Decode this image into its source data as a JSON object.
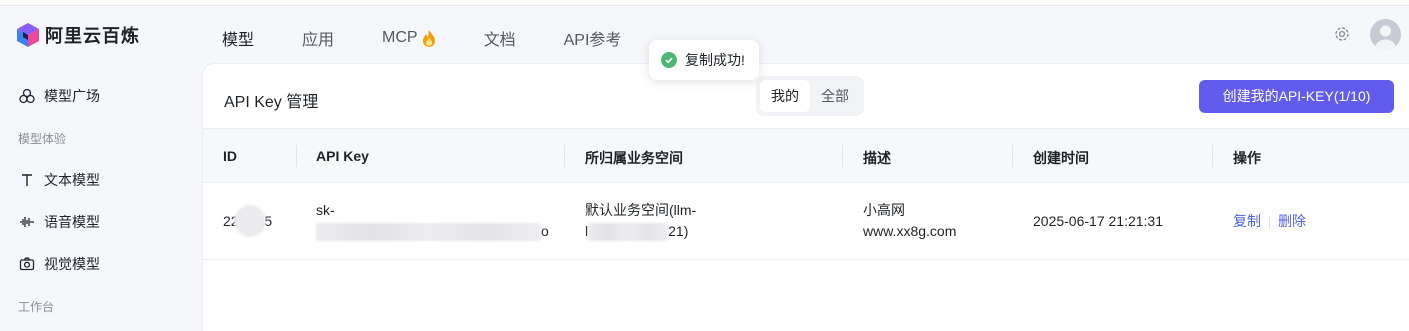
{
  "brand": {
    "name": "阿里云百炼"
  },
  "nav": {
    "items": [
      "模型",
      "应用",
      "MCP",
      "文档",
      "API参考"
    ],
    "active": "模型"
  },
  "toast": {
    "text": "复制成功!"
  },
  "sidebar": {
    "model_square": "模型广场",
    "group_experience": "模型体验",
    "text_model": "文本模型",
    "voice_model": "语音模型",
    "vision_model": "视觉模型",
    "group_workbench": "工作台"
  },
  "panel": {
    "title": "API Key 管理",
    "filter_mine": "我的",
    "filter_all": "全部",
    "create_button": "创建我的API-KEY(1/10)"
  },
  "table": {
    "columns": [
      "ID",
      "API Key",
      "所归属业务空间",
      "描述",
      "创建时间",
      "操作"
    ],
    "rows": [
      {
        "id_prefix": "22",
        "id_suffix": "25",
        "key_prefix": "sk-",
        "key_tail": "o",
        "workspace_line1": "默认业务空间(llm-",
        "workspace_line2_prefix": "l",
        "workspace_line2_suffix": "21)",
        "desc_line1": "小高网",
        "desc_line2": "www.xx8g.com",
        "created": "2025-06-17 21:21:31",
        "action_copy": "复制",
        "action_delete": "删除"
      }
    ]
  },
  "colors": {
    "accent": "#615ced",
    "link": "#4e63e0",
    "success": "#4cb872"
  }
}
